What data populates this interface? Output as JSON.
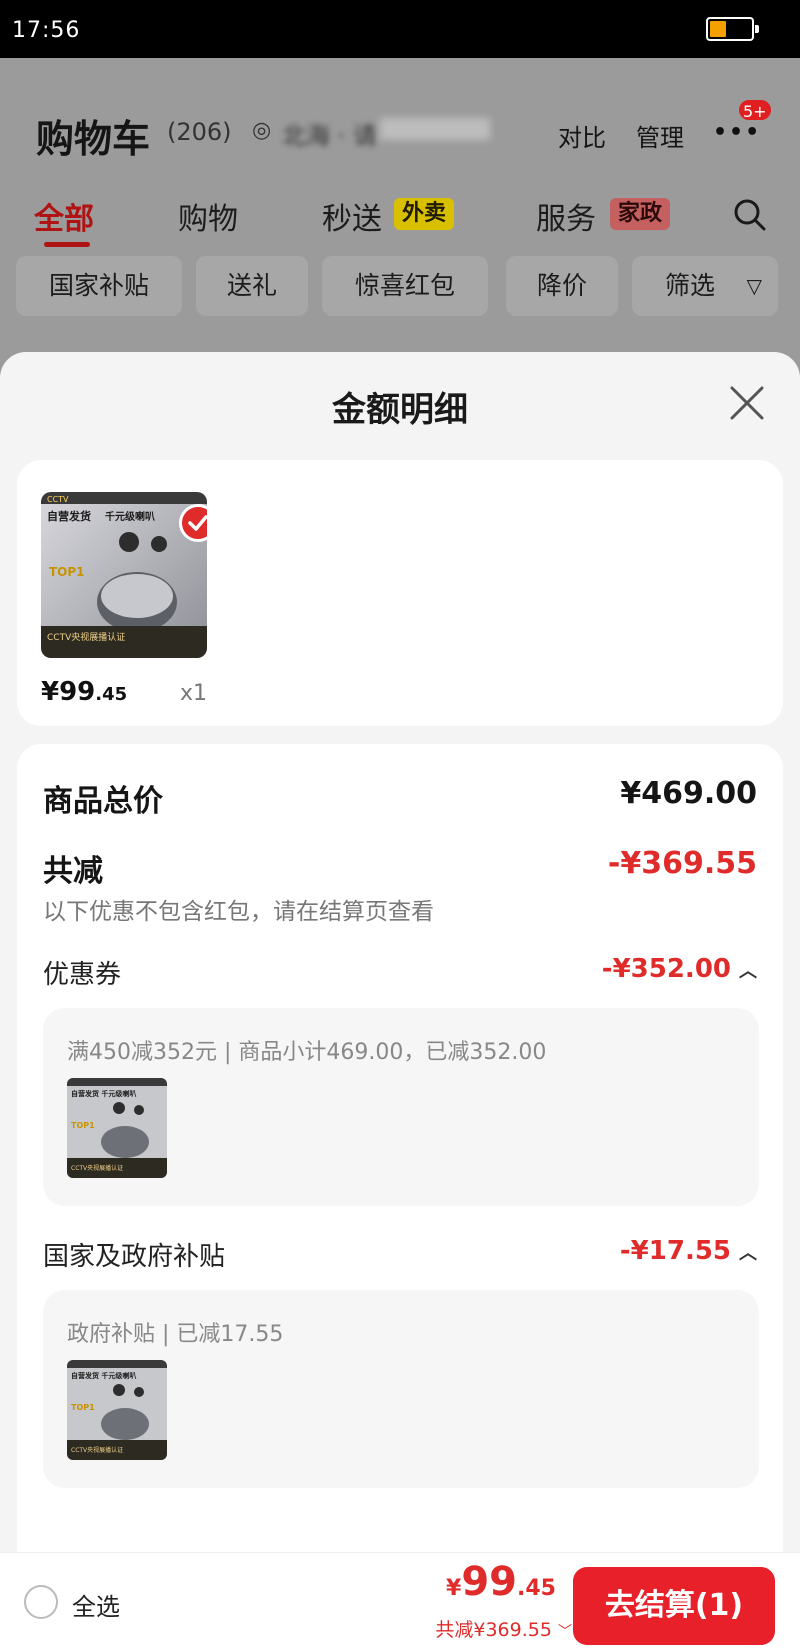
{
  "status_bar": {
    "time": "17:56",
    "battery_level": 0.4
  },
  "cart_header": {
    "title": "购物车",
    "count": "(206)",
    "location": "北海 · 请",
    "compare_label": "对比",
    "manage_label": "管理",
    "badge": "5+"
  },
  "tabs": [
    {
      "label": "全部",
      "active": true
    },
    {
      "label": "购物"
    },
    {
      "label": "秒送",
      "tag": "外卖"
    },
    {
      "label": "服务",
      "tag": "家政"
    }
  ],
  "filter_chips": [
    "国家补贴",
    "送礼",
    "惊喜红包",
    "降价",
    "筛选"
  ],
  "sheet": {
    "title": "金额明细",
    "product": {
      "price_int": "¥99",
      "price_dec": ".45",
      "qty": "x1",
      "image_texts": [
        "自营发货",
        "千元级喇叭",
        "TOP1",
        "CCTV央视展播认证"
      ]
    },
    "summary": {
      "goods_total_label": "商品总价",
      "goods_total_value": "¥469.00",
      "reduced_label": "共减",
      "reduced_value": "-¥369.55",
      "note": "以下优惠不包含红包，请在结算页查看"
    },
    "coupon": {
      "label": "优惠券",
      "value": "-¥352.00",
      "desc": "满450减352元 | 商品小计469.00，已减352.00"
    },
    "subsidy": {
      "label": "国家及政府补贴",
      "value": "-¥17.55",
      "desc": "政府补贴 | 已减17.55"
    }
  },
  "bottom_bar": {
    "select_all": "全选",
    "price_symbol": "¥",
    "price_int": "99",
    "price_dec": ".45",
    "total_reduced": "共减¥369.55",
    "checkout": "去结算(1)"
  },
  "colors": {
    "accent_red": "#e02b2b",
    "tab_red": "#b01313",
    "sheet_bg": "#f4f4f4"
  }
}
